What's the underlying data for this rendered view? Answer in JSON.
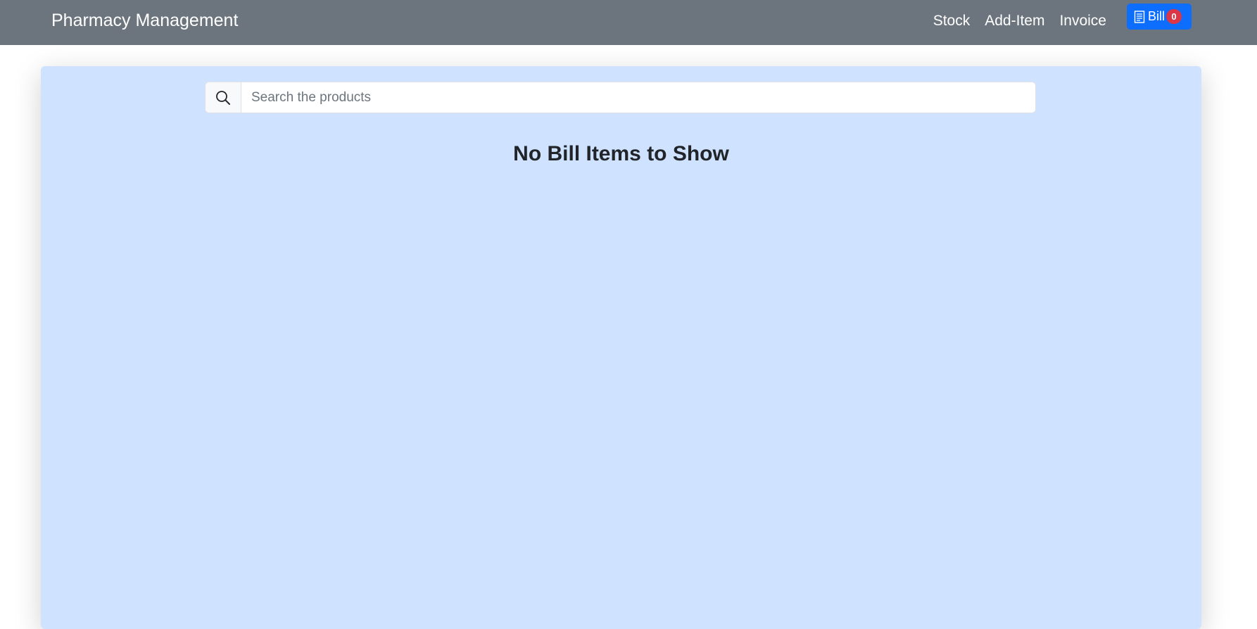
{
  "navbar": {
    "brand": "Pharmacy Management",
    "links": [
      "Stock",
      "Add-Item",
      "Invoice"
    ],
    "bill_button": {
      "label": "Bill",
      "icon": "receipt-icon",
      "count": "0"
    }
  },
  "search": {
    "icon": "search-icon",
    "placeholder": "Search the products",
    "value": ""
  },
  "main": {
    "empty_message": "No Bill Items to Show"
  },
  "colors": {
    "navbar_bg": "#6c757d",
    "card_bg": "#cfe2ff",
    "bill_button_bg": "#0d6efd",
    "badge_bg": "#dc3545"
  }
}
